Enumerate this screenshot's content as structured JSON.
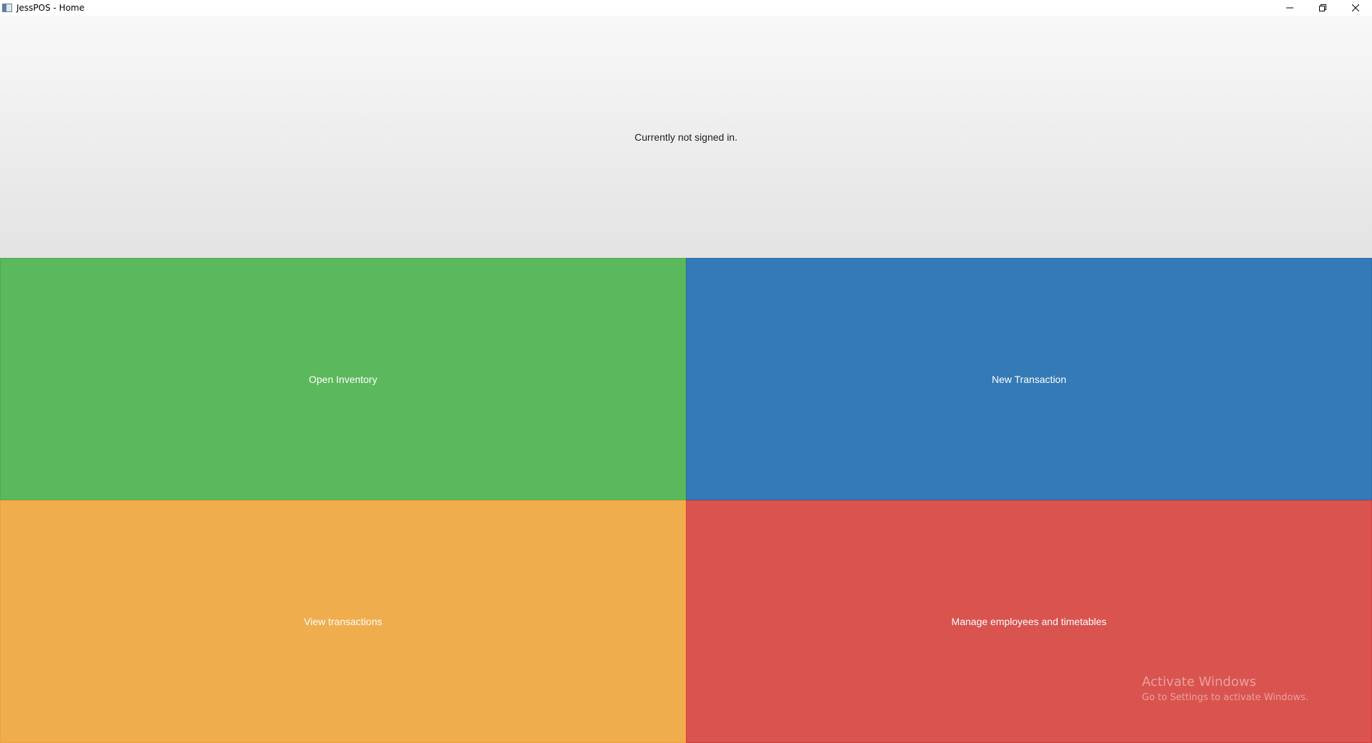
{
  "window": {
    "title": "JessPOS - Home",
    "controls": {
      "minimize_icon": "minimize-icon",
      "restore_icon": "restore-icon",
      "close_icon": "close-icon"
    }
  },
  "header": {
    "status": "Currently not signed in."
  },
  "tiles": [
    {
      "label": "Open Inventory",
      "color": "#5cb85c"
    },
    {
      "label": "New Transaction",
      "color": "#337ab7"
    },
    {
      "label": "View transactions",
      "color": "#f0ad4e"
    },
    {
      "label": "Manage employees and timetables",
      "color": "#d9534f"
    }
  ],
  "watermark": {
    "title": "Activate Windows",
    "subtitle": "Go to Settings to activate Windows."
  }
}
